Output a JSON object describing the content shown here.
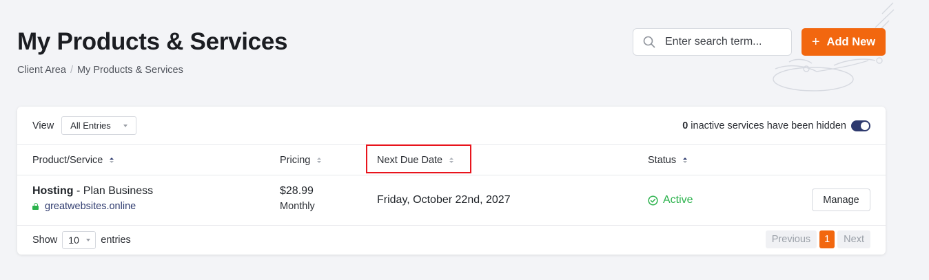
{
  "page": {
    "title": "My Products & Services",
    "breadcrumb": [
      "Client Area",
      "My Products & Services"
    ]
  },
  "search": {
    "placeholder": "Enter search term..."
  },
  "add_button": {
    "label": "Add New",
    "icon": "plus-icon"
  },
  "toolbar": {
    "view_label": "View",
    "view_selected": "All Entries",
    "inactive_count": "0",
    "inactive_text": "inactive services have been hidden",
    "toggle_on": true
  },
  "table": {
    "columns": [
      {
        "label": "Product/Service",
        "sort": "active"
      },
      {
        "label": "Pricing",
        "sort": "none"
      },
      {
        "label": "Next Due Date",
        "sort": "none",
        "highlighted": true
      },
      {
        "label": "Status",
        "sort": "active"
      }
    ],
    "rows": [
      {
        "product": "Hosting",
        "plan": " - Plan Business",
        "domain": "greatwebsites.online",
        "price": "$28.99",
        "cycle": "Monthly",
        "due_date": "Friday, October 22nd, 2027",
        "status": "Active",
        "action": "Manage"
      }
    ]
  },
  "footer": {
    "show_label": "Show",
    "length_selected": "10",
    "entries_label": "entries",
    "pagination": {
      "previous": "Previous",
      "current": "1",
      "next": "Next"
    }
  },
  "colors": {
    "accent": "#f2670f",
    "primary": "#2e3a6e",
    "success": "#2bb24c",
    "highlight_border": "#e8141c"
  }
}
